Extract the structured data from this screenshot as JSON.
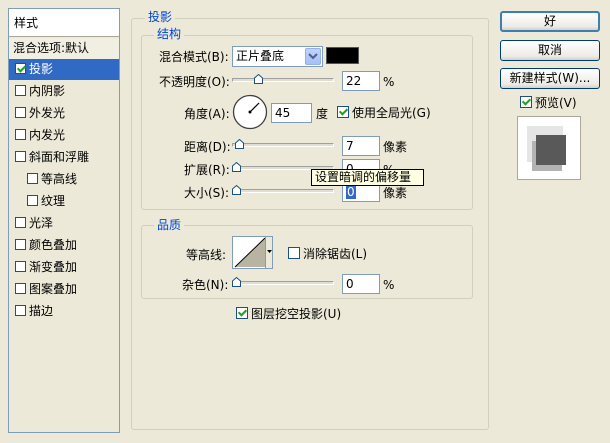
{
  "style_list": {
    "header": "样式",
    "blend_options": "混合选项:默认",
    "items": [
      {
        "label": "投影",
        "checked": true,
        "indent": false,
        "selected": true
      },
      {
        "label": "内阴影",
        "checked": false,
        "indent": false
      },
      {
        "label": "外发光",
        "checked": false,
        "indent": false
      },
      {
        "label": "内发光",
        "checked": false,
        "indent": false
      },
      {
        "label": "斜面和浮雕",
        "checked": false,
        "indent": false
      },
      {
        "label": "等高线",
        "checked": false,
        "indent": true
      },
      {
        "label": "纹理",
        "checked": false,
        "indent": true
      },
      {
        "label": "光泽",
        "checked": false,
        "indent": false
      },
      {
        "label": "颜色叠加",
        "checked": false,
        "indent": false
      },
      {
        "label": "渐变叠加",
        "checked": false,
        "indent": false
      },
      {
        "label": "图案叠加",
        "checked": false,
        "indent": false
      },
      {
        "label": "描边",
        "checked": false,
        "indent": false
      }
    ]
  },
  "drop_shadow": {
    "title": "投影",
    "structure": {
      "title": "结构",
      "blend_mode_label": "混合模式(B):",
      "blend_mode_value": "正片叠底",
      "shadow_color": "#000000",
      "opacity_label": "不透明度(O):",
      "opacity_value": "22",
      "opacity_unit": "%",
      "opacity_level": 0.22,
      "angle_label": "角度(A):",
      "angle_value": "45",
      "angle_unit": "度",
      "global_light_label": "使用全局光(G)",
      "global_light_checked": true,
      "distance_label": "距离(D):",
      "distance_value": "7",
      "distance_unit": "像素",
      "spread_label": "扩展(R):",
      "spread_value": "0",
      "spread_unit": "%",
      "size_label": "大小(S):",
      "size_value": "0",
      "size_unit": "像素"
    },
    "quality": {
      "title": "品质",
      "contour_label": "等高线:",
      "anti_alias_label": "消除锯齿(L)",
      "anti_alias_checked": false,
      "noise_label": "杂色(N):",
      "noise_value": "0",
      "noise_unit": "%"
    },
    "knockout_label": "图层挖空投影(U)",
    "knockout_checked": true
  },
  "tooltip": "设置暗调的偏移量",
  "buttons": {
    "ok": "好",
    "cancel": "取消",
    "new_style": "新建样式(W)...",
    "preview_label": "预览(V)",
    "preview_checked": true
  }
}
